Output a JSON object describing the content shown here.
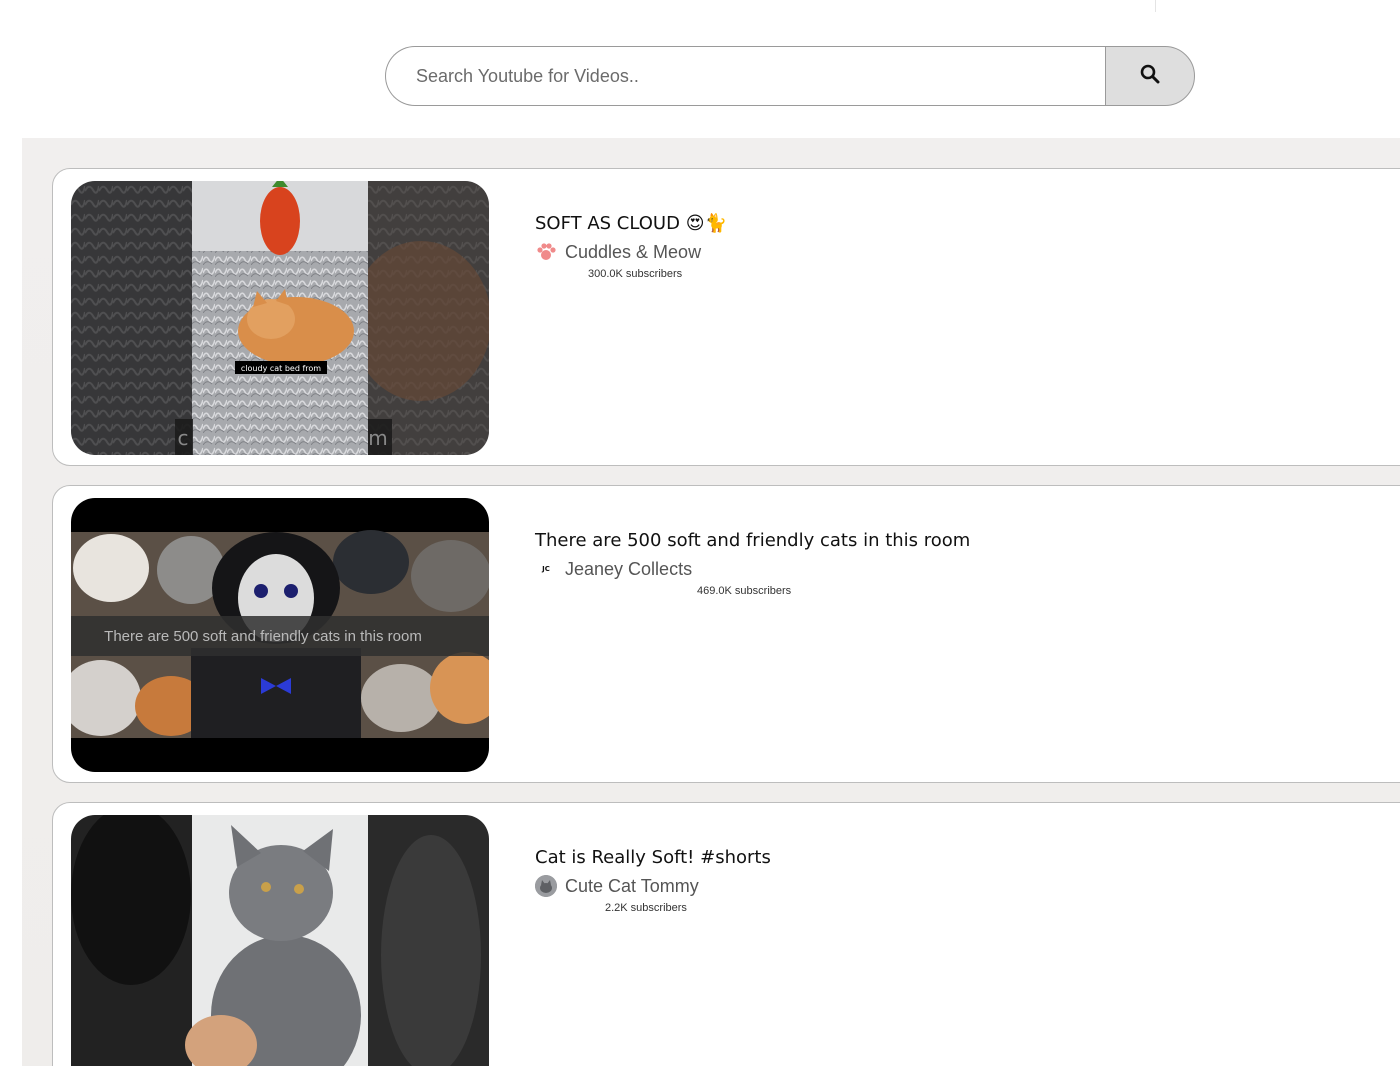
{
  "search": {
    "placeholder": "Search Youtube for Videos..",
    "value": "",
    "button_icon": "search-icon"
  },
  "results": [
    {
      "title": "SOFT AS CLOUD 😍🐈",
      "channel": "Cuddles & Meow",
      "channel_avatar": "paw-avatar",
      "subscribers": "300.0K subscribers",
      "thumbnail_caption": "cloudy cat bed from",
      "thumbnail_edge_left": "c",
      "thumbnail_edge_right": "m"
    },
    {
      "title": "There are 500 soft and friendly cats in this room",
      "channel": "Jeaney Collects",
      "channel_avatar_text": "JC",
      "subscribers": "469.0K subscribers",
      "thumbnail_caption": "There are 500 soft and friendly cats in this room"
    },
    {
      "title": "Cat is Really Soft! #shorts",
      "channel": "Cute Cat Tommy",
      "channel_avatar": "cat-photo-avatar",
      "subscribers": "2.2K subscribers"
    }
  ],
  "colors": {
    "panel_background": "#efedeb",
    "card_border": "#bdbdbd",
    "search_button_bg": "#dedede",
    "paw_accent": "#f08a8a"
  }
}
